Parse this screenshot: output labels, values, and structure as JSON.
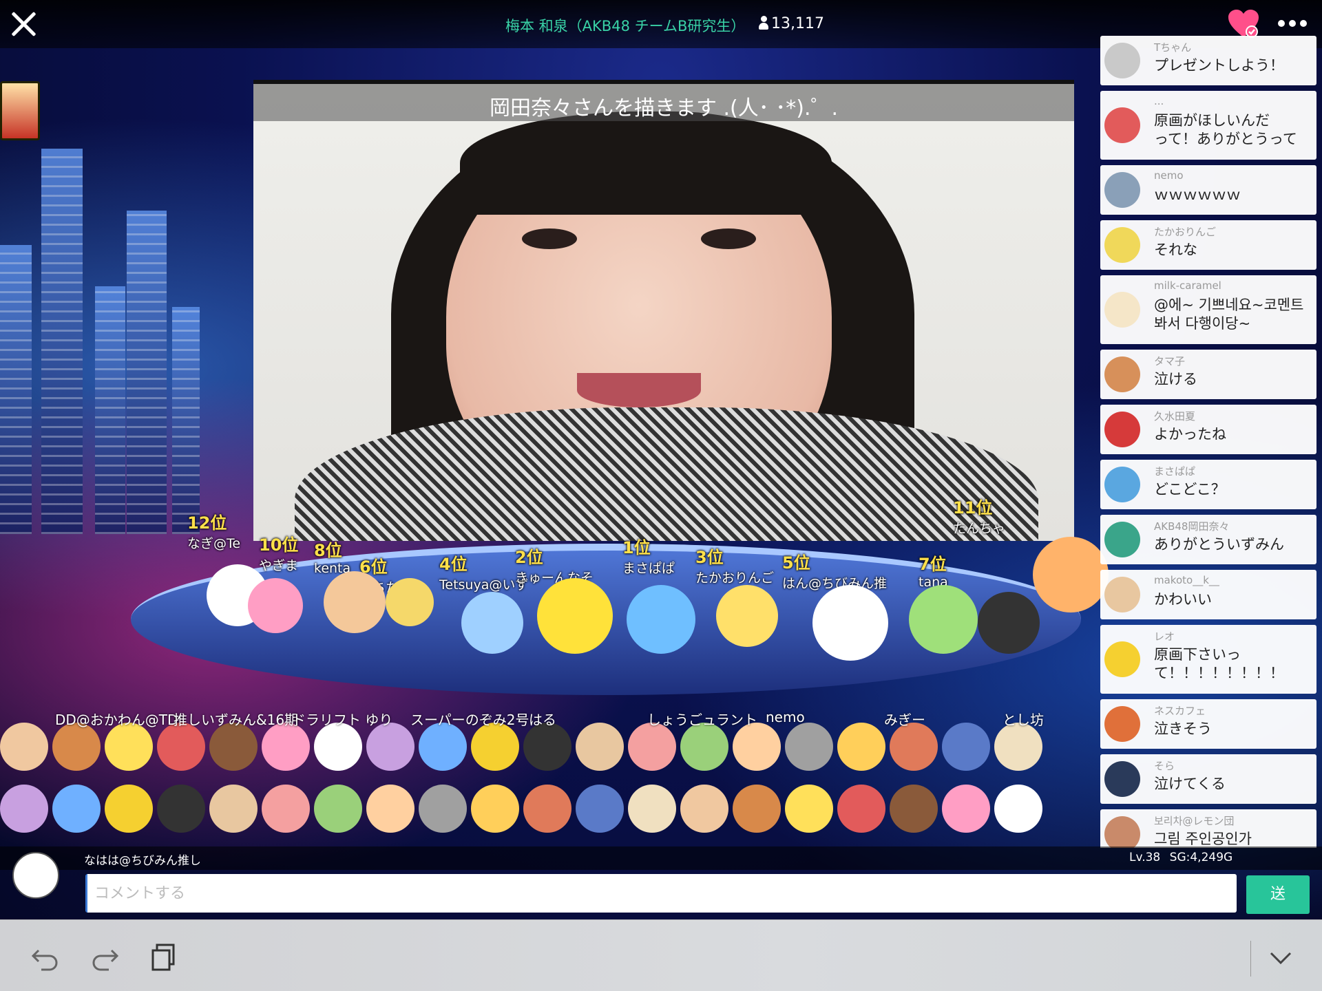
{
  "header": {
    "title": "梅本 和泉（AKB48 チームB研究生）",
    "viewer_count": "13,117"
  },
  "video": {
    "caption": "岡田奈々さんを描きます .(人･ ･*).゜."
  },
  "ranking": [
    {
      "rank": "12位",
      "name": "なぎ@Te"
    },
    {
      "rank": "10位",
      "name": "やぎま"
    },
    {
      "rank": "8位",
      "name": "kenta"
    },
    {
      "rank": "6位",
      "name": "もちたろう"
    },
    {
      "rank": "4位",
      "name": "Tetsuya@いず"
    },
    {
      "rank": "2位",
      "name": "きゅーんなそ"
    },
    {
      "rank": "1位",
      "name": "まさぱぱ"
    },
    {
      "rank": "3位",
      "name": "たかおりんご"
    },
    {
      "rank": "5位",
      "name": "はん@ちびみん推"
    },
    {
      "rank": "7位",
      "name": "tana"
    },
    {
      "rank": "11位",
      "name": "たんちゃ"
    }
  ],
  "crowd_names": [
    "DD@おかわん@TD",
    "推しいずみん&16期",
    "ドラリフト ゆり",
    "スーパーのぞみ2号",
    "はる",
    "しょうごュラント",
    "nemo",
    "みぎー",
    "とし坊"
  ],
  "comments": [
    {
      "user": "Tちゃん",
      "text": "プレゼントしよう！",
      "avatar_color": "#c9c9c9"
    },
    {
      "user": "...",
      "text": "原画がほしいんだ\nって！ありがとうって",
      "avatar_color": "#e25b5b"
    },
    {
      "user": "nemo",
      "text": "ｗｗｗｗｗｗ",
      "avatar_color": "#8aa0b8"
    },
    {
      "user": "たかおりんご",
      "text": "それな",
      "avatar_color": "#f0d85a"
    },
    {
      "user": "milk-caramel",
      "text": "@에~ 기쁘네요~코멘트\n봐서 다행이당~",
      "avatar_color": "#f5e6c8"
    },
    {
      "user": "タマ子",
      "text": "泣ける",
      "avatar_color": "#d7905a"
    },
    {
      "user": "久水田夏",
      "text": "よかったね",
      "avatar_color": "#d63a3a"
    },
    {
      "user": "まさぱぱ",
      "text": "どこどこ？",
      "avatar_color": "#5aa7e0"
    },
    {
      "user": "AKB48岡田奈々",
      "text": "ありがとういずみん",
      "avatar_color": "#3aa58a"
    },
    {
      "user": "makoto__k__",
      "text": "かわいい",
      "avatar_color": "#e8c7a0"
    },
    {
      "user": "レオ",
      "text": "原画下さいっ\nて！！！！！！！！",
      "avatar_color": "#f5d030"
    },
    {
      "user": "ネスカフェ",
      "text": "泣きそう",
      "avatar_color": "#e0703a"
    },
    {
      "user": "そら",
      "text": "泣けてくる",
      "avatar_color": "#2a3a5a"
    },
    {
      "user": "보리차@レモン団",
      "text": "그림 주인공인가",
      "avatar_color": "#c98a6a"
    }
  ],
  "commenter_bar": {
    "name": "なはは@ちびみん推し",
    "level": "Lv.38",
    "sg": "SG:4,249G"
  },
  "input": {
    "placeholder": "コメントする",
    "send_label": "送"
  },
  "toolbar": {
    "undo_icon": "undo-icon",
    "redo_icon": "redo-icon",
    "clipboard_icon": "clipboard-icon",
    "collapse_icon": "chevron-down-icon"
  },
  "colors": {
    "title_accent": "#39d2a6",
    "heart": "#ff4f8a",
    "send": "#28c59a"
  }
}
